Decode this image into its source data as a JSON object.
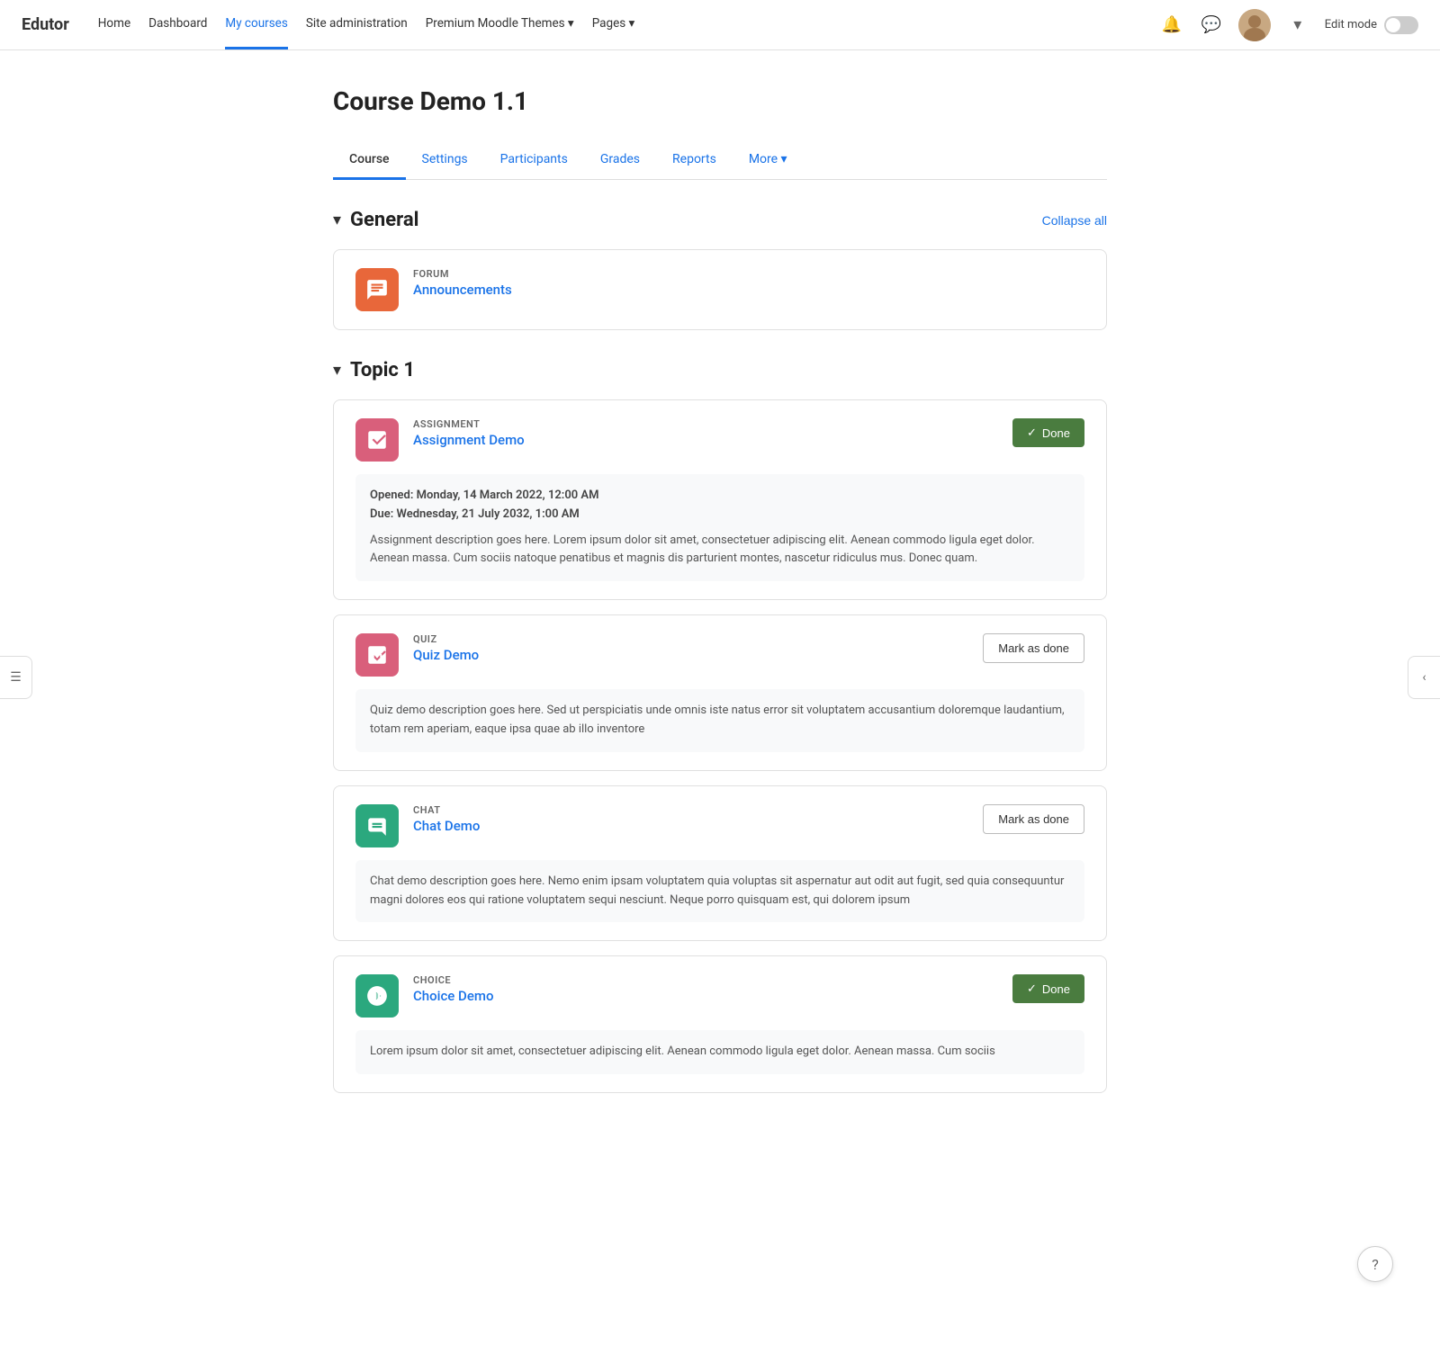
{
  "brand": "Edutor",
  "nav": {
    "links": [
      {
        "label": "Home",
        "active": false
      },
      {
        "label": "Dashboard",
        "active": false
      },
      {
        "label": "My courses",
        "active": true
      },
      {
        "label": "Site administration",
        "active": false
      },
      {
        "label": "Premium Moodle Themes ▾",
        "active": false
      },
      {
        "label": "Pages ▾",
        "active": false
      }
    ],
    "edit_mode_label": "Edit mode"
  },
  "page_title": "Course Demo 1.1",
  "tabs": [
    {
      "label": "Course",
      "active": true
    },
    {
      "label": "Settings",
      "active": false
    },
    {
      "label": "Participants",
      "active": false
    },
    {
      "label": "Grades",
      "active": false
    },
    {
      "label": "Reports",
      "active": false
    },
    {
      "label": "More ▾",
      "active": false
    }
  ],
  "sections": [
    {
      "id": "general",
      "title": "General",
      "collapse_label": "Collapse all",
      "activities": [
        {
          "type": "FORUM",
          "name": "Announcements",
          "icon_color": "#e8673a",
          "icon_type": "forum",
          "status": null,
          "has_details": false
        }
      ]
    },
    {
      "id": "topic1",
      "title": "Topic 1",
      "collapse_label": null,
      "activities": [
        {
          "type": "ASSIGNMENT",
          "name": "Assignment Demo",
          "icon_color": "#d95f7b",
          "icon_type": "assignment",
          "status": "done",
          "has_details": true,
          "opened_label": "Opened:",
          "opened_value": "Monday, 14 March 2022, 12:00 AM",
          "due_label": "Due:",
          "due_value": "Wednesday, 21 July 2032, 1:00 AM",
          "description": "Assignment description goes here. Lorem ipsum dolor sit amet, consectetuer adipiscing elit. Aenean commodo ligula eget dolor. Aenean massa. Cum sociis natoque penatibus et magnis dis parturient montes, nascetur ridiculus mus. Donec quam."
        },
        {
          "type": "QUIZ",
          "name": "Quiz Demo",
          "icon_color": "#d95f7b",
          "icon_type": "quiz",
          "status": "mark",
          "has_details": true,
          "description": "Quiz demo description goes here. Sed ut perspiciatis unde omnis iste natus error sit voluptatem accusantium doloremque laudantium, totam rem aperiam, eaque ipsa quae ab illo inventore"
        },
        {
          "type": "CHAT",
          "name": "Chat Demo",
          "icon_color": "#2ba87e",
          "icon_type": "chat",
          "status": "mark",
          "has_details": true,
          "description": "Chat demo description goes here. Nemo enim ipsam voluptatem quia voluptas sit aspernatur aut odit aut fugit, sed quia consequuntur magni dolores eos qui ratione voluptatem sequi nesciunt. Neque porro quisquam est, qui dolorem ipsum"
        },
        {
          "type": "CHOICE",
          "name": "Choice Demo",
          "icon_color": "#2ba87e",
          "icon_type": "choice",
          "status": "done",
          "has_details": true,
          "description": "Lorem ipsum dolor sit amet, consectetuer adipiscing elit. Aenean commodo ligula eget dolor. Aenean massa. Cum sociis"
        }
      ]
    }
  ],
  "buttons": {
    "done_label": "✓ Done",
    "mark_label": "Mark as done"
  }
}
